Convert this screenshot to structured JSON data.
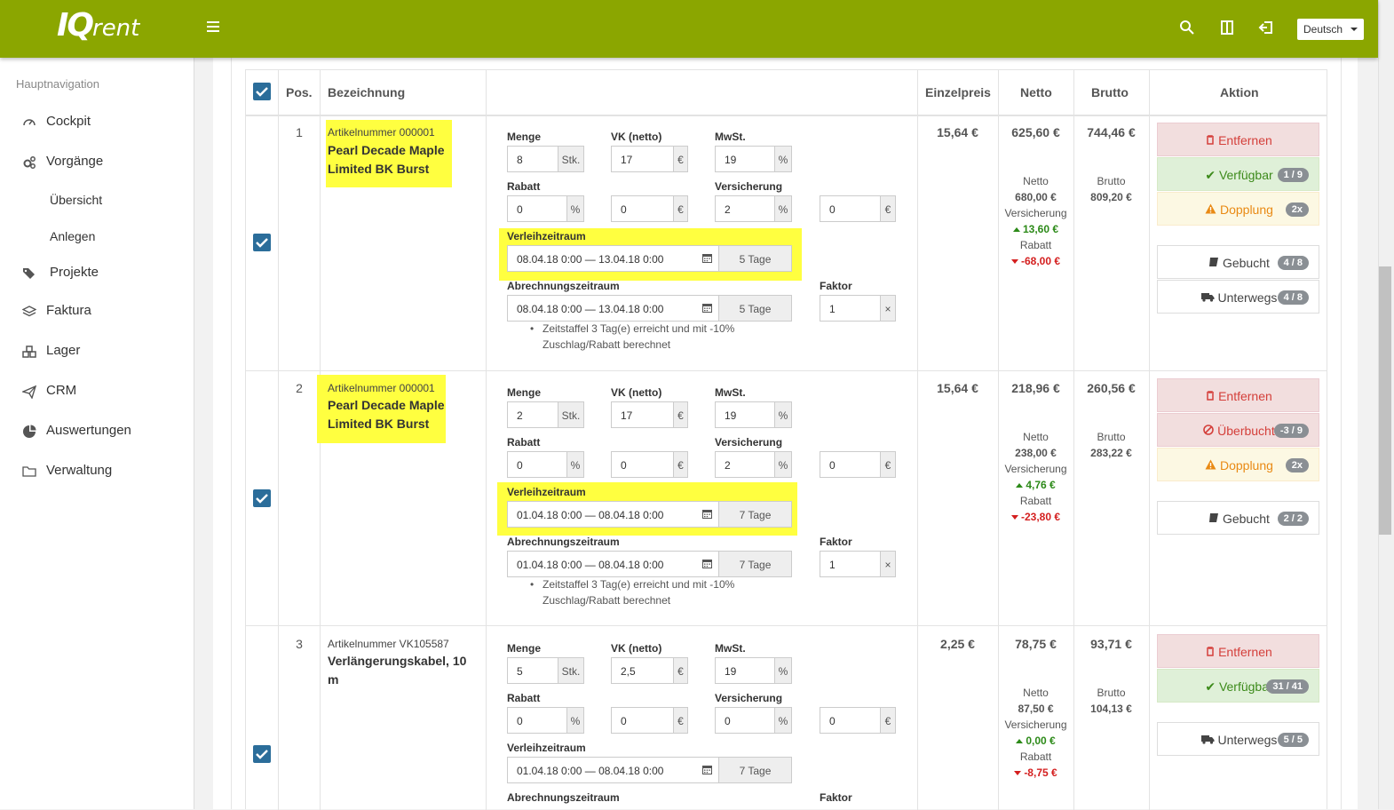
{
  "header": {
    "logo_bold": "IQ",
    "logo_rest": "rent",
    "language": "Deutsch",
    "brand_color": "#8ba600"
  },
  "sidebar": {
    "title": "Hauptnavigation",
    "items": [
      {
        "label": "Cockpit",
        "icon": "gauge-icon"
      },
      {
        "label": "Vorgänge",
        "icon": "gears-icon"
      },
      {
        "label": "Übersicht",
        "icon": ""
      },
      {
        "label": "Anlegen",
        "icon": ""
      },
      {
        "label": "Projekte",
        "icon": "tags-icon"
      },
      {
        "label": "Faktura",
        "icon": "layers-icon"
      },
      {
        "label": "Lager",
        "icon": "boxes-icon"
      },
      {
        "label": "CRM",
        "icon": "paper-plane-icon"
      },
      {
        "label": "Auswertungen",
        "icon": "pie-chart-icon"
      },
      {
        "label": "Verwaltung",
        "icon": "folder-icon"
      }
    ]
  },
  "table": {
    "headers": {
      "pos": "Pos.",
      "bezeichnung": "Bezeichnung",
      "einzelpreis": "Einzelpreis",
      "netto": "Netto",
      "brutto": "Brutto",
      "aktion": "Aktion"
    },
    "labels": {
      "menge": "Menge",
      "vk": "VK (netto)",
      "mwst": "MwSt.",
      "rabatt": "Rabatt",
      "versicherung": "Versicherung",
      "verleihzeitraum": "Verleihzeitraum",
      "abrechnungszeitraum": "Abrechnungszeitraum",
      "faktor": "Faktor",
      "stk": "Stk.",
      "percent": "%",
      "euro": "€",
      "times": "×",
      "netto": "Netto",
      "brutto": "Brutto",
      "versicherung_small": "Versicherung",
      "rabatt_small": "Rabatt"
    },
    "rows": [
      {
        "pos": "1",
        "artno": "Artikelnummer 000001",
        "name": "Pearl Decade Maple Limited BK Burst",
        "menge": "8",
        "vk": "17",
        "mwst": "19",
        "rabatt": "0",
        "rabatt_eur": "0",
        "versicherung": "2",
        "versicherung_eur": "0",
        "verleih": "08.04.18 0:00 — 13.04.18 0:00",
        "verleih_tage": "5 Tage",
        "abrechnung": "08.04.18 0:00 — 13.04.18 0:00",
        "abrechnung_tage": "5 Tage",
        "faktor": "1",
        "note": "Zeitstaffel 3 Tag(e) erreicht und mit -10% Zuschlag/Rabatt berechnet",
        "einzelpreis": "15,64 €",
        "netto": "625,60 €",
        "brutto": "744,46 €",
        "netto_base": "680,00 €",
        "versicherung_val": "13,60 €",
        "rabatt_val": "-68,00 €",
        "brutto_base": "809,20 €",
        "actions": {
          "remove": "Entfernen",
          "status": "Verfügbar",
          "status_badge": "1 / 9",
          "dup": "Dopplung",
          "dup_badge": "2x",
          "booked": "Gebucht",
          "booked_badge": "4 / 8",
          "transit": "Unterwegs",
          "transit_badge": "4 / 8"
        }
      },
      {
        "pos": "2",
        "artno": "Artikelnummer 000001",
        "name": "Pearl Decade Maple Limited BK Burst",
        "menge": "2",
        "vk": "17",
        "mwst": "19",
        "rabatt": "0",
        "rabatt_eur": "0",
        "versicherung": "2",
        "versicherung_eur": "0",
        "verleih": "01.04.18 0:00 — 08.04.18 0:00",
        "verleih_tage": "7 Tage",
        "abrechnung": "01.04.18 0:00 — 08.04.18 0:00",
        "abrechnung_tage": "7 Tage",
        "faktor": "1",
        "note": "Zeitstaffel 3 Tag(e) erreicht und mit -10% Zuschlag/Rabatt berechnet",
        "einzelpreis": "15,64 €",
        "netto": "218,96 €",
        "brutto": "260,56 €",
        "netto_base": "238,00 €",
        "versicherung_val": "4,76 €",
        "rabatt_val": "-23,80 €",
        "brutto_base": "283,22 €",
        "actions": {
          "remove": "Entfernen",
          "status": "Überbucht",
          "status_badge": "-3 / 9",
          "dup": "Dopplung",
          "dup_badge": "2x",
          "booked": "Gebucht",
          "booked_badge": "2 / 2"
        }
      },
      {
        "pos": "3",
        "artno": "Artikelnummer VK105587",
        "name": "Verlängerungskabel, 10 m",
        "menge": "5",
        "vk": "2,5",
        "mwst": "19",
        "rabatt": "0",
        "rabatt_eur": "0",
        "versicherung": "0",
        "versicherung_eur": "0",
        "verleih": "01.04.18 0:00 — 08.04.18 0:00",
        "verleih_tage": "7 Tage",
        "einzelpreis": "2,25 €",
        "netto": "78,75 €",
        "brutto": "93,71 €",
        "netto_base": "87,50 €",
        "versicherung_val": "0,00 €",
        "rabatt_val": "-8,75 €",
        "brutto_base": "104,13 €",
        "actions": {
          "remove": "Entfernen",
          "status": "Verfügbar",
          "status_badge": "31 / 41",
          "transit": "Unterwegs",
          "transit_badge": "5 / 5"
        }
      }
    ]
  }
}
